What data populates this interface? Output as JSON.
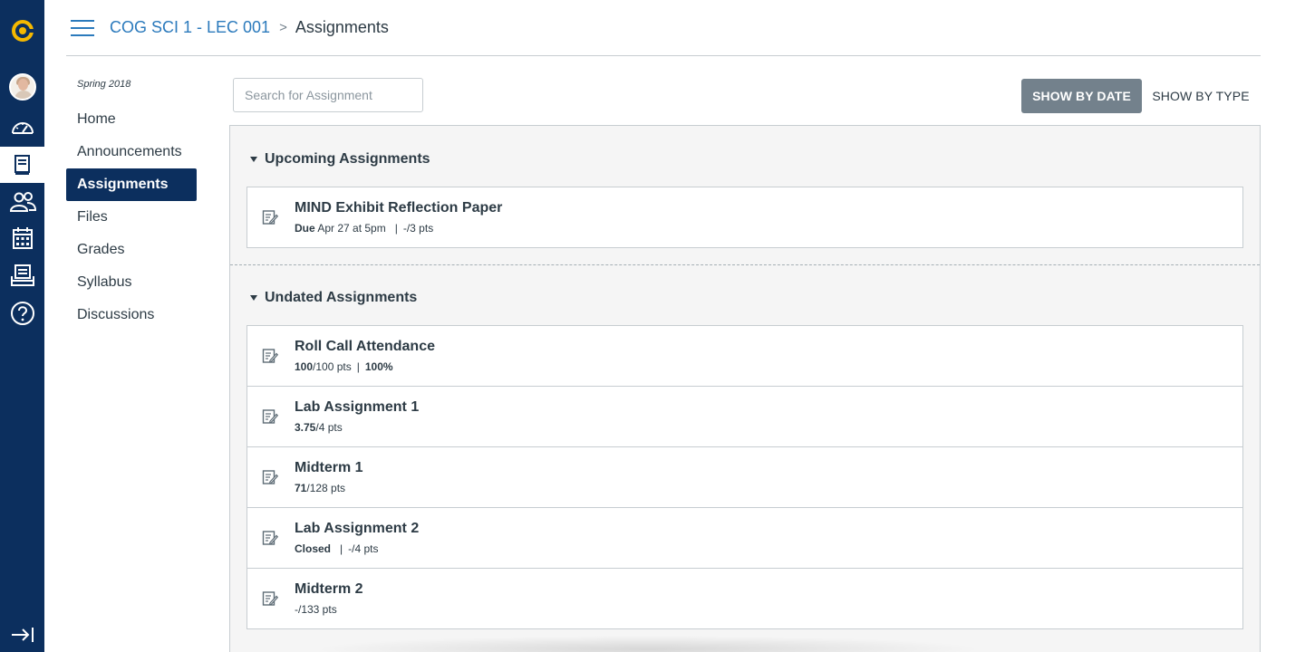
{
  "header": {
    "course_link": "COG SCI 1 - LEC 001",
    "separator": ">",
    "current_page": "Assignments"
  },
  "course_nav": {
    "term": "Spring 2018",
    "items": [
      {
        "label": "Home"
      },
      {
        "label": "Announcements"
      },
      {
        "label": "Assignments",
        "active": true
      },
      {
        "label": "Files"
      },
      {
        "label": "Grades"
      },
      {
        "label": "Syllabus"
      },
      {
        "label": "Discussions"
      }
    ]
  },
  "toolbar": {
    "search_placeholder": "Search for Assignment",
    "show_by_date": "SHOW BY DATE",
    "show_by_type": "SHOW BY TYPE"
  },
  "groups": [
    {
      "title": "Upcoming Assignments",
      "assignments": [
        {
          "title": "MIND Exhibit Reflection Paper",
          "meta_bold": "Due",
          "meta_rest": "Apr 27 at 5pm",
          "meta_sep": "|",
          "meta_pts": "-/3 pts"
        }
      ]
    },
    {
      "title": "Undated Assignments",
      "assignments": [
        {
          "title": "Roll Call Attendance",
          "score": "100",
          "pts": "/100 pts",
          "sep": "|",
          "percent": "100%"
        },
        {
          "title": "Lab Assignment 1",
          "score": "3.75",
          "pts": "/4 pts"
        },
        {
          "title": "Midterm 1",
          "score": "71",
          "pts": "/128 pts"
        },
        {
          "title": "Lab Assignment 2",
          "status": "Closed",
          "sep": "|",
          "pts": "-/4 pts"
        },
        {
          "title": "Midterm 2",
          "pts": "-/133 pts"
        }
      ]
    }
  ],
  "colors": {
    "global_nav": "#0c2f5e",
    "link": "#2b7abc",
    "brand_logo": "#f5b800",
    "active_button": "#73818c"
  },
  "icons": [
    "canvas-logo-icon",
    "dashboard-icon",
    "courses-icon",
    "groups-icon",
    "calendar-icon",
    "inbox-icon",
    "help-icon",
    "collapse-nav-icon",
    "hamburger-icon",
    "assignment-icon"
  ]
}
